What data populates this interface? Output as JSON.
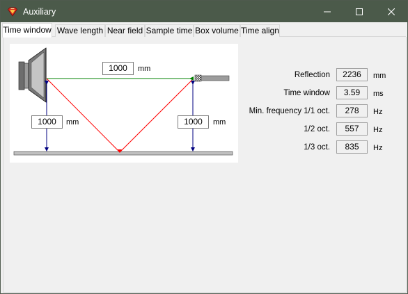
{
  "window": {
    "title": "Auxiliary"
  },
  "tabs": [
    {
      "label": "Time window",
      "active": true
    },
    {
      "label": "Wave length",
      "active": false
    },
    {
      "label": "Near field",
      "active": false
    },
    {
      "label": "Sample time",
      "active": false
    },
    {
      "label": "Box volume",
      "active": false
    },
    {
      "label": "Time align",
      "active": false
    }
  ],
  "diagram": {
    "distance": {
      "value": "1000",
      "unit": "mm"
    },
    "speaker_height": {
      "value": "1000",
      "unit": "mm"
    },
    "mic_height": {
      "value": "1000",
      "unit": "mm"
    },
    "colors": {
      "direct_path": "#008000",
      "reflected_path": "#ff0000",
      "height_arrows": "#000080",
      "floor": "#c0c0c0"
    }
  },
  "results": [
    {
      "label": "Reflection",
      "value": "2236",
      "unit": "mm"
    },
    {
      "label": "Time window",
      "value": "3.59",
      "unit": "ms"
    },
    {
      "label": "Min. frequency 1/1 oct.",
      "value": "278",
      "unit": "Hz"
    },
    {
      "label": "1/2 oct.",
      "value": "557",
      "unit": "Hz"
    },
    {
      "label": "1/3 oct.",
      "value": "835",
      "unit": "Hz"
    }
  ]
}
